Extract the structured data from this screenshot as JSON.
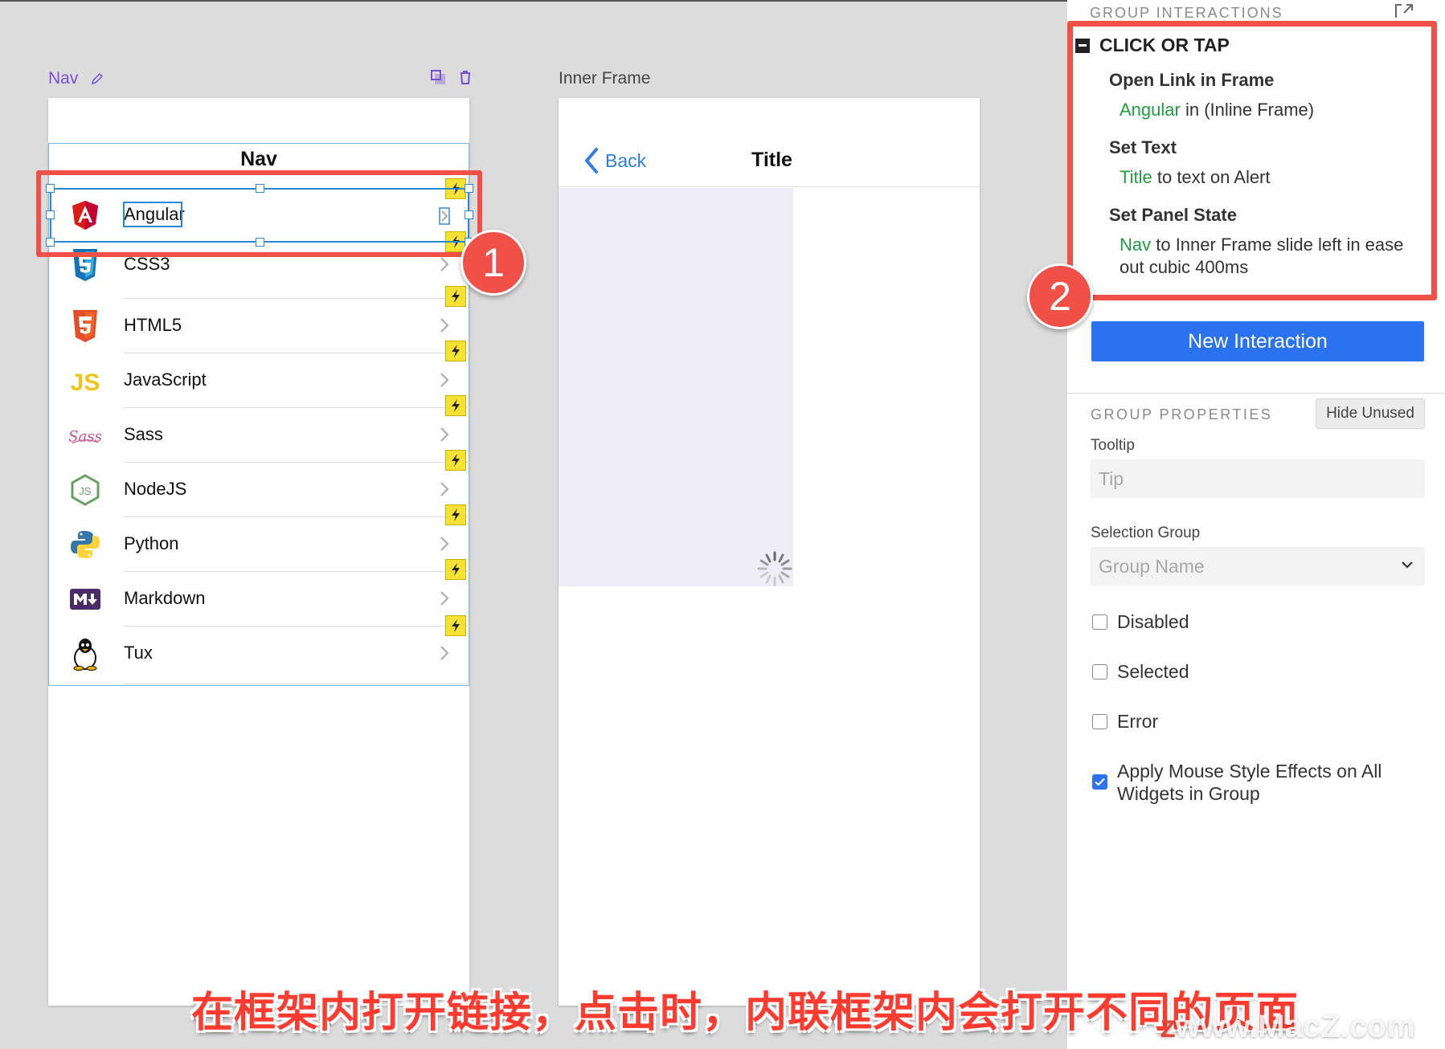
{
  "canvas": {
    "nav_label": "Nav",
    "inner_label": "Inner Frame",
    "nav_title": "Nav",
    "nav_items": [
      {
        "label": "Angular",
        "icon": "angular-icon"
      },
      {
        "label": "CSS3",
        "icon": "css3-icon"
      },
      {
        "label": "HTML5",
        "icon": "html5-icon"
      },
      {
        "label": "JavaScript",
        "icon": "javascript-icon"
      },
      {
        "label": "Sass",
        "icon": "sass-icon"
      },
      {
        "label": "NodeJS",
        "icon": "nodejs-icon"
      },
      {
        "label": "Python",
        "icon": "python-icon"
      },
      {
        "label": "Markdown",
        "icon": "markdown-icon"
      },
      {
        "label": "Tux",
        "icon": "tux-icon"
      }
    ],
    "back_label": "Back",
    "inner_title": "Title",
    "badge1": "1",
    "badge2": "2"
  },
  "panel": {
    "group_interactions_title": "GROUP INTERACTIONS",
    "event": "CLICK OR TAP",
    "actions": [
      {
        "title": "Open Link in Frame",
        "target": "Angular",
        "rest": " in (Inline Frame)"
      },
      {
        "title": "Set Text",
        "target": "Title",
        "rest": " to text on Alert"
      },
      {
        "title": "Set Panel State",
        "target": "Nav",
        "rest": " to Inner Frame slide left in ease out cubic 400ms"
      }
    ],
    "new_interaction": "New Interaction",
    "group_properties_title": "GROUP PROPERTIES",
    "hide_unused": "Hide Unused",
    "tooltip_label": "Tooltip",
    "tooltip_placeholder": "Tip",
    "selection_group_label": "Selection Group",
    "selection_group_placeholder": "Group Name",
    "checkboxes": [
      {
        "label": "Disabled",
        "checked": false
      },
      {
        "label": "Selected",
        "checked": false
      },
      {
        "label": "Error",
        "checked": false
      },
      {
        "label": "Apply Mouse Style Effects on All Widgets in Group",
        "checked": true
      }
    ]
  },
  "overlay": {
    "subtitle": "在框架内打开链接，点击时，内联框架内会打开不同的页面",
    "watermark": "www.MacZ.com",
    "watermark_logo": "Z"
  },
  "colors": {
    "accent_blue": "#2a72f0",
    "annotation_red": "#f05046",
    "target_green": "#1e9e3e",
    "bolt_yellow": "#f6e235",
    "nav_purple": "#7a4fd6"
  }
}
